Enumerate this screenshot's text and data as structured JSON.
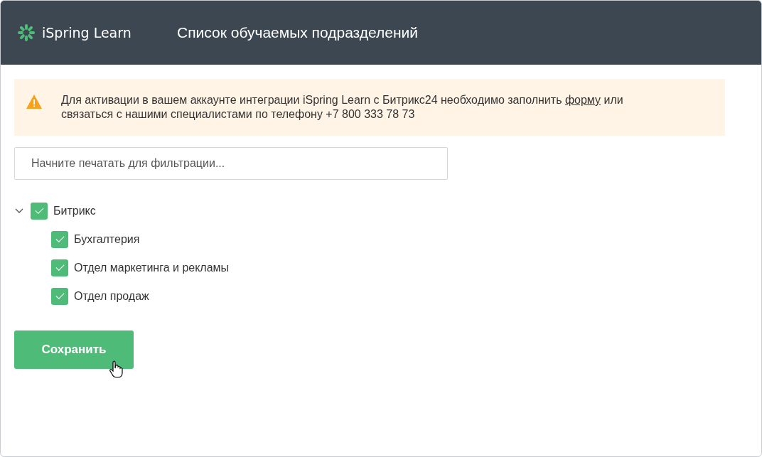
{
  "header": {
    "logo": "iSpring Learn",
    "title": "Список обучаемых подразделений"
  },
  "notice": {
    "text_before": "Для активации в вашем аккаунте интеграции iSpring Learn с Битрикс24 необходимо заполнить ",
    "link": "форму",
    "text_after": " или связаться с нашими специалистами по телефону +7 800 333 78 73"
  },
  "filter": {
    "placeholder": "Начните печатать для фильтрации..."
  },
  "tree": [
    {
      "label": "Битрикс",
      "checked": true,
      "expanded": true,
      "children": [
        {
          "label": "Бухгалтерия",
          "checked": true
        },
        {
          "label": "Отдел маркетинга и рекламы",
          "checked": true
        },
        {
          "label": "Отдел продаж",
          "checked": true
        }
      ]
    }
  ],
  "save_button": "Сохранить"
}
